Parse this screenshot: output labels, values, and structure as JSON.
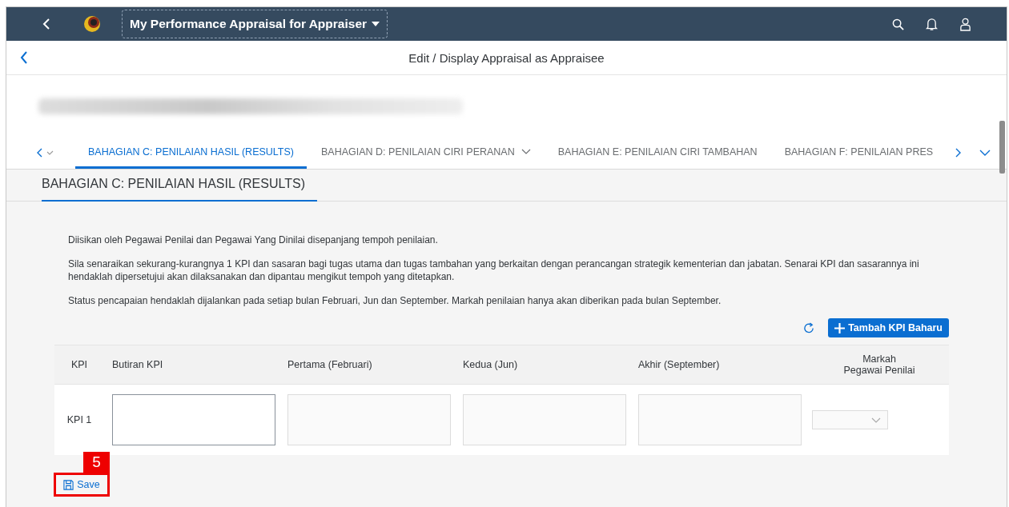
{
  "shell": {
    "title": "My Performance Appraisal for Appraiser"
  },
  "page": {
    "title": "Edit / Display Appraisal as Appraisee"
  },
  "tabs": [
    {
      "label": "BAHAGIAN C: PENILAIAN HASIL (RESULTS)",
      "selected": true,
      "kind": "plain"
    },
    {
      "label": "BAHAGIAN D: PENILAIAN CIRI PERANAN",
      "selected": false,
      "kind": "menu"
    },
    {
      "label": "BAHAGIAN E: PENILAIAN CIRI TAMBAHAN",
      "selected": false,
      "kind": "plain"
    },
    {
      "label": "BAHAGIAN F: PENILAIAN PRES",
      "selected": false,
      "kind": "plain"
    }
  ],
  "section": {
    "title": "BAHAGIAN C: PENILAIAN HASIL (RESULTS)"
  },
  "paragraphs": [
    "Diisikan oleh Pegawai Penilai dan Pegawai Yang Dinilai disepanjang tempoh penilaian.",
    "Sila senaraikan sekurang-kurangnya 1 KPI dan sasaran bagi tugas utama dan tugas tambahan yang berkaitan dengan perancangan strategik kementerian dan jabatan. Senarai KPI dan sasarannya ini hendaklah dipersetujui akan dilaksanakan dan dipantau mengikut tempoh yang ditetapkan.",
    "Status pencapaian hendaklah dijalankan pada setiap bulan Februari, Jun dan September. Markah penilaian hanya akan diberikan pada bulan September."
  ],
  "add_button": {
    "label": "Tambah KPI Baharu"
  },
  "table": {
    "columns": [
      "KPI",
      "Butiran KPI",
      "Pertama (Februari)",
      "Kedua (Jun)",
      "Akhir (September)",
      "Markah\nPegawai Penilai"
    ],
    "rows": [
      {
        "label": "KPI 1",
        "cells": [
          {
            "kind": "text",
            "disabled": false
          },
          {
            "kind": "text",
            "disabled": true
          },
          {
            "kind": "text",
            "disabled": true
          },
          {
            "kind": "text",
            "disabled": true
          },
          {
            "kind": "select",
            "disabled": true
          }
        ]
      }
    ]
  },
  "callout": {
    "number": "5"
  },
  "save_button": {
    "label": "Save"
  }
}
